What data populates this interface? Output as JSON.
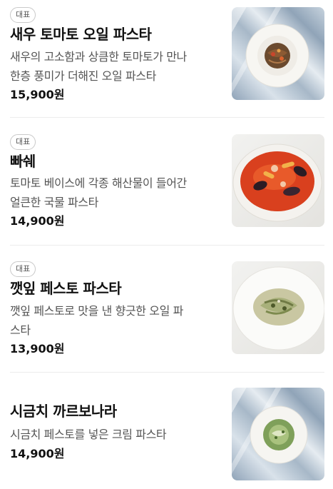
{
  "menu": {
    "items": [
      {
        "badge": "대표",
        "name": "새우 토마토 오일 파스타",
        "desc_line1": "새우의 고소함과 상큼한 토마토가 만나",
        "desc_line2": "한층 풍미가 더해진 오일 파스타",
        "price": "15,900원",
        "image_icon": "shrimp-tomato-pasta-photo"
      },
      {
        "badge": "대표",
        "name": "빠쉐",
        "desc_line1": "토마토 베이스에 각종 해산물이 들어간",
        "desc_line2": "얼큰한 국물 파스타",
        "price": "14,900원",
        "image_icon": "seafood-soup-pasta-photo"
      },
      {
        "badge": "대표",
        "name": "깻잎 페스토 파스타",
        "desc_line1": "깻잎 페스토로 맛을 낸 향긋한 오일 파",
        "desc_line2": "스타",
        "price": "13,900원",
        "image_icon": "perilla-pesto-pasta-photo"
      },
      {
        "name": "시금치 까르보나라",
        "desc_line1": "시금치 페스토를 넣은 크림 파스타",
        "price": "14,900원",
        "image_icon": "spinach-carbonara-photo"
      }
    ]
  }
}
